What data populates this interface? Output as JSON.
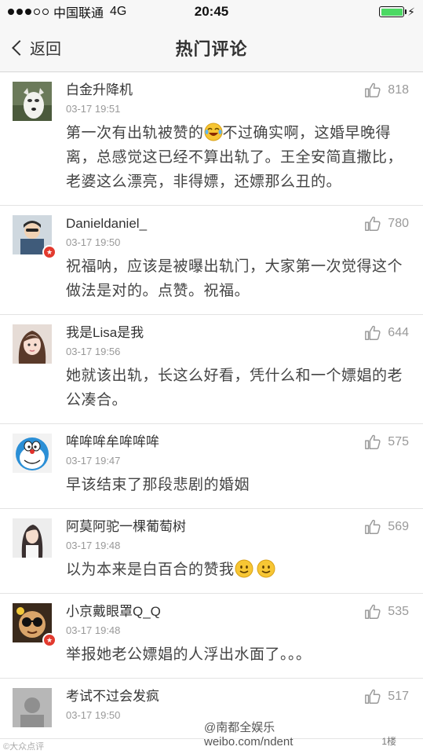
{
  "status_bar": {
    "carrier": "中国联通",
    "network": "4G",
    "time": "20:45"
  },
  "nav": {
    "back_label": "返回",
    "title": "热门评论"
  },
  "comments": [
    {
      "name": "白金升降机",
      "time": "03-17 19:51",
      "likes": "818",
      "text_before": "第一次有出轨被赞的",
      "emoji": "laugh-cry",
      "text_after": "不过确实啊，这婚早晚得离，总感觉这已经不算出轨了。王全安简直撒比，老婆这么漂亮，非得嫖，还嫖那么丑的。",
      "badge": false,
      "avatar": "white-dog-avatar"
    },
    {
      "name": "Danieldaniel_",
      "time": "03-17 19:50",
      "likes": "780",
      "text": "祝福呐，应该是被曝出轨门，大家第一次觉得这个做法是对的。点赞。祝福。",
      "badge": true,
      "avatar": "cartoon-man-avatar"
    },
    {
      "name": "我是Lisa是我",
      "time": "03-17 19:56",
      "likes": "644",
      "text": "她就该出轨，长这么好看，凭什么和一个嫖娼的老公凑合。",
      "badge": false,
      "avatar": "girl-avatar"
    },
    {
      "name": "哞哞哞牟哞哞哞",
      "time": "03-17 19:47",
      "likes": "575",
      "text": "早该结束了那段悲剧的婚姻",
      "badge": false,
      "avatar": "doraemon-avatar"
    },
    {
      "name": "阿莫阿驼一棵葡萄树",
      "time": "03-17 19:48",
      "likes": "569",
      "text": "以为本来是白百合的赞我",
      "emoji": "smile",
      "badge": false,
      "avatar": "woman-avatar"
    },
    {
      "name": "小京戴眼罩Q_Q",
      "time": "03-17 19:48",
      "likes": "535",
      "text": "举报她老公嫖娼的人浮出水面了。。。",
      "badge": true,
      "avatar": "sunglasses-avatar"
    },
    {
      "name": "考试不过会发疯",
      "time": "03-17 19:50",
      "likes": "517",
      "badge": false,
      "avatar": "grey-avatar"
    }
  ],
  "watermark": {
    "handle": "@南都全娱乐",
    "url": "weibo.com/ndent",
    "corner_left": "©大众点评",
    "corner_right": "1楼"
  },
  "colors": {
    "bar_bg": "#f7f7f7",
    "text": "#444444",
    "meta": "#999999",
    "badge": "#e23a2e",
    "battery": "#4cd964"
  }
}
